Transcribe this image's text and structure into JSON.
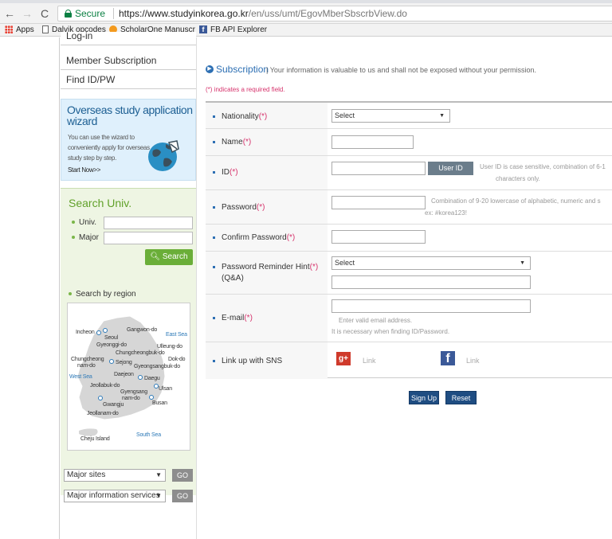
{
  "browser": {
    "secure_label": "Secure",
    "url_host": "https://www.studyinkorea.go.kr",
    "url_path": "/en/uss/umt/EgovMberSbscrbView.do",
    "bookmarks": [
      {
        "label": "Apps",
        "icon": "apps-icon"
      },
      {
        "label": "Dalvik opcodes",
        "icon": "page-icon"
      },
      {
        "label": "ScholarOne Manuscr",
        "icon": "scholarone-icon"
      },
      {
        "label": "FB API Explorer",
        "icon": "facebook-icon"
      }
    ]
  },
  "sidebar": {
    "menu": [
      "Log-in",
      "Member Subscription",
      "Find ID/PW"
    ],
    "wizard": {
      "title": "Overseas study application wizard",
      "desc": "You can use the wizard to conveniently apply for overseas study step by step.",
      "start": "Start Now>>"
    },
    "search": {
      "title": "Search Univ.",
      "univ_label": "Univ.",
      "major_label": "Major",
      "button": "Search",
      "region_label": "Search by region"
    },
    "map_labels": {
      "incheon": "Incheon",
      "seoul": "Seoul",
      "gangwon": "Gangwon-do",
      "east_sea": "East Sea",
      "gyeonggi": "Gyeonggi-do",
      "ulleung": "Ulleung-do",
      "chungbuk": "Chungcheongbuk-do",
      "chungnam1": "Chungcheong",
      "chungnam2": "nam-do",
      "sejong": "Sejong",
      "dokdo": "Dok-do",
      "gyeongbuk": "Gyeongsangbuk-do",
      "west_sea": "West Sea",
      "daejeon": "Daejeon",
      "daegu": "Daegu",
      "jeonbuk": "Jeollabuk-do",
      "ulsan": "Ulsan",
      "gyeongnam1": "Gyengsang",
      "gyeongnam2": "nam-do",
      "gwangju": "Gwangju",
      "busan": "Busan",
      "jeonnam": "Jeollanam-do",
      "jeju": "Cheju Island",
      "south_sea": "South Sea"
    },
    "major_sites": "Major sites",
    "major_info": "Major information services",
    "go": "GO"
  },
  "content": {
    "title": "Subscription",
    "desc": "Your information is valuable to us and shall not be exposed without your permission.",
    "required_note": "(*) indicates a required field.",
    "req_mark": "(*)",
    "fields": {
      "nationality": "Nationality",
      "name": "Name",
      "id": "ID",
      "password": "Password",
      "confirm_password": "Confirm Password",
      "hint1": "Password Reminder Hint",
      "hint2": "(Q&A)",
      "email": "E-mail",
      "sns": "Link up with SNS"
    },
    "select_placeholder": "Select",
    "id_check_button": "User ID Check",
    "id_hint1": "User ID is case sensitive, combination of 6-1",
    "id_hint2": "characters only.",
    "pw_hint1": "Combination of 9-20 lowercase of alphabetic, numeric and s",
    "pw_hint2": "ex: #korea123!",
    "email_hint1": "Enter valid email address.",
    "email_hint2": "It is necessary when finding ID/Password.",
    "gplus_glyph": "g+",
    "fb_glyph": "f",
    "link": "Link",
    "signup": "Sign Up",
    "reset": "Reset"
  }
}
